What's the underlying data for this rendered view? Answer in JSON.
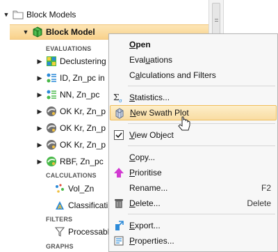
{
  "tree": {
    "root": {
      "label": "Block Models"
    },
    "model": {
      "label": "Block Model"
    },
    "headings": {
      "evaluations": "EVALUATIONS",
      "calculations": "CALCULATIONS",
      "filters": "FILTERS",
      "graphs": "GRAPHS"
    },
    "evaluations": [
      {
        "label": "Declustering"
      },
      {
        "label": "ID, Zn_pc in"
      },
      {
        "label": "NN, Zn_pc"
      },
      {
        "label": "OK Kr, Zn_p"
      },
      {
        "label": "OK Kr, Zn_p"
      },
      {
        "label": "OK Kr, Zn_p"
      },
      {
        "label": "RBF, Zn_pc"
      }
    ],
    "calculations": [
      {
        "label": "Vol_Zn"
      },
      {
        "label": "Classificati"
      }
    ],
    "filters": [
      {
        "label": "Processable"
      }
    ]
  },
  "menu": {
    "open": {
      "pre": "",
      "key": "O",
      "post": "pen"
    },
    "evaluations": {
      "pre": "Eval",
      "key": "u",
      "post": "ations"
    },
    "calculations": {
      "pre": "C",
      "key": "a",
      "post": "lculations and Filters"
    },
    "statistics": {
      "pre": "",
      "key": "S",
      "post": "tatistics..."
    },
    "swath": {
      "pre": "",
      "key": "N",
      "post": "ew Swath Plot"
    },
    "view_object": {
      "pre": "",
      "key": "V",
      "post": "iew Object"
    },
    "copy": {
      "pre": "",
      "key": "C",
      "post": "opy..."
    },
    "prioritise": {
      "pre": "",
      "key": "P",
      "post": "rioritise"
    },
    "rename": {
      "label": "Rename...",
      "shortcut": "F2"
    },
    "delete": {
      "pre": "",
      "key": "D",
      "post": "elete...",
      "shortcut": "Delete"
    },
    "export": {
      "pre": "",
      "key": "E",
      "post": "xport..."
    },
    "properties": {
      "pre": "",
      "key": "P",
      "post": "roperties..."
    }
  },
  "colors": {
    "selected_row": "#f8d18b",
    "menu_hover": "#f9dca2",
    "menu_bg": "#f7f7f7"
  }
}
